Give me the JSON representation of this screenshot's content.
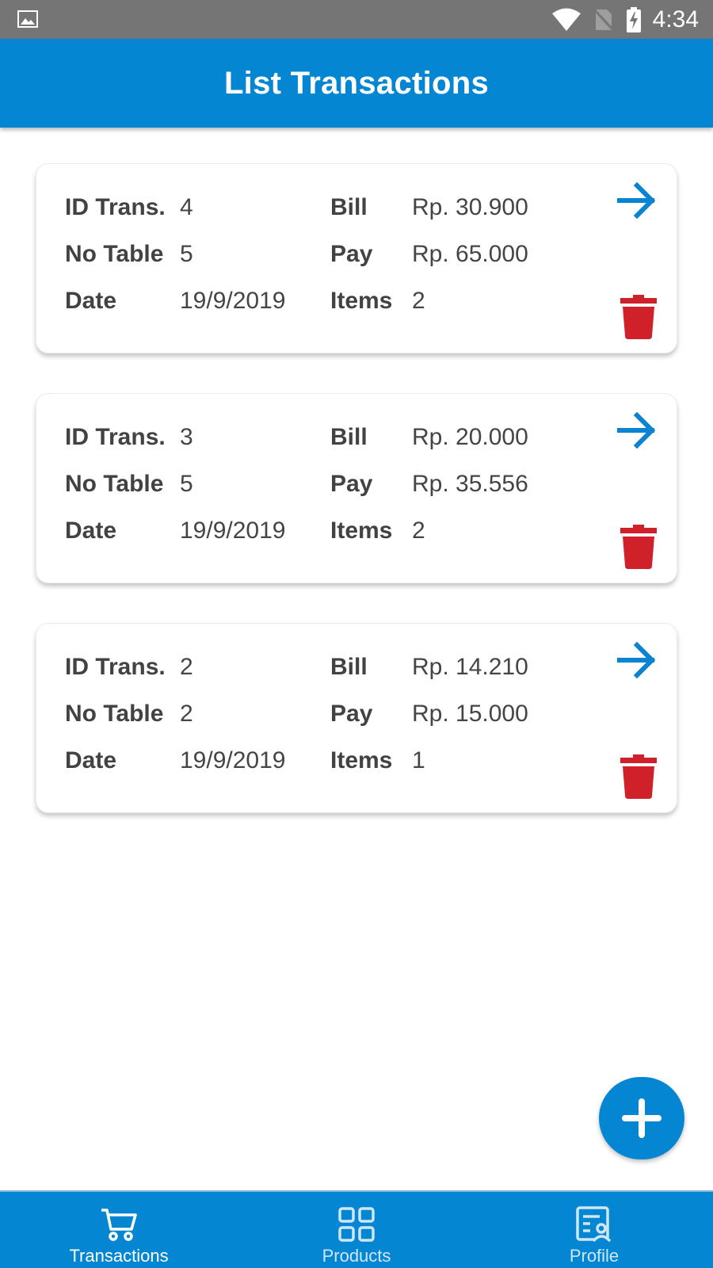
{
  "status_bar": {
    "time": "4:34"
  },
  "app_bar": {
    "title": "List Transactions"
  },
  "labels": {
    "id_trans": "ID Trans.",
    "no_table": "No Table",
    "date": "Date",
    "bill": "Bill",
    "pay": "Pay",
    "items": "Items"
  },
  "transactions": [
    {
      "id": "4",
      "table": "5",
      "date": "19/9/2019",
      "bill": "Rp. 30.900",
      "pay": "Rp. 65.000",
      "items": "2"
    },
    {
      "id": "3",
      "table": "5",
      "date": "19/9/2019",
      "bill": "Rp. 20.000",
      "pay": "Rp. 35.556",
      "items": "2"
    },
    {
      "id": "2",
      "table": "2",
      "date": "19/9/2019",
      "bill": "Rp. 14.210",
      "pay": "Rp. 15.000",
      "items": "1"
    }
  ],
  "bottom_nav": {
    "items": [
      {
        "label": "Transactions",
        "icon": "cart-icon",
        "active": true
      },
      {
        "label": "Products",
        "icon": "grid-icon",
        "active": false
      },
      {
        "label": "Profile",
        "icon": "profile-icon",
        "active": false
      }
    ]
  },
  "colors": {
    "primary": "#0586d2",
    "status_bar": "#757575",
    "delete": "#d0202a",
    "arrow": "#0a84d0"
  }
}
